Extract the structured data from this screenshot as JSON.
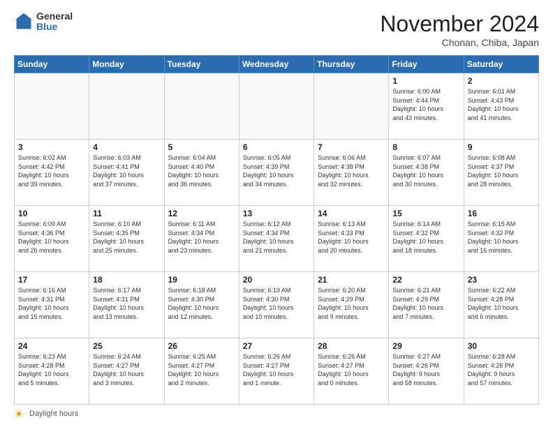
{
  "header": {
    "logo_general": "General",
    "logo_blue": "Blue",
    "month_title": "November 2024",
    "location": "Chonan, Chiba, Japan"
  },
  "calendar": {
    "days_of_week": [
      "Sunday",
      "Monday",
      "Tuesday",
      "Wednesday",
      "Thursday",
      "Friday",
      "Saturday"
    ],
    "weeks": [
      [
        {
          "day": "",
          "info": ""
        },
        {
          "day": "",
          "info": ""
        },
        {
          "day": "",
          "info": ""
        },
        {
          "day": "",
          "info": ""
        },
        {
          "day": "",
          "info": ""
        },
        {
          "day": "1",
          "info": "Sunrise: 6:00 AM\nSunset: 4:44 PM\nDaylight: 10 hours\nand 43 minutes."
        },
        {
          "day": "2",
          "info": "Sunrise: 6:01 AM\nSunset: 4:43 PM\nDaylight: 10 hours\nand 41 minutes."
        }
      ],
      [
        {
          "day": "3",
          "info": "Sunrise: 6:02 AM\nSunset: 4:42 PM\nDaylight: 10 hours\nand 39 minutes."
        },
        {
          "day": "4",
          "info": "Sunrise: 6:03 AM\nSunset: 4:41 PM\nDaylight: 10 hours\nand 37 minutes."
        },
        {
          "day": "5",
          "info": "Sunrise: 6:04 AM\nSunset: 4:40 PM\nDaylight: 10 hours\nand 36 minutes."
        },
        {
          "day": "6",
          "info": "Sunrise: 6:05 AM\nSunset: 4:39 PM\nDaylight: 10 hours\nand 34 minutes."
        },
        {
          "day": "7",
          "info": "Sunrise: 6:06 AM\nSunset: 4:38 PM\nDaylight: 10 hours\nand 32 minutes."
        },
        {
          "day": "8",
          "info": "Sunrise: 6:07 AM\nSunset: 4:38 PM\nDaylight: 10 hours\nand 30 minutes."
        },
        {
          "day": "9",
          "info": "Sunrise: 6:08 AM\nSunset: 4:37 PM\nDaylight: 10 hours\nand 28 minutes."
        }
      ],
      [
        {
          "day": "10",
          "info": "Sunrise: 6:09 AM\nSunset: 4:36 PM\nDaylight: 10 hours\nand 26 minutes."
        },
        {
          "day": "11",
          "info": "Sunrise: 6:10 AM\nSunset: 4:35 PM\nDaylight: 10 hours\nand 25 minutes."
        },
        {
          "day": "12",
          "info": "Sunrise: 6:11 AM\nSunset: 4:34 PM\nDaylight: 10 hours\nand 23 minutes."
        },
        {
          "day": "13",
          "info": "Sunrise: 6:12 AM\nSunset: 4:34 PM\nDaylight: 10 hours\nand 21 minutes."
        },
        {
          "day": "14",
          "info": "Sunrise: 6:13 AM\nSunset: 4:33 PM\nDaylight: 10 hours\nand 20 minutes."
        },
        {
          "day": "15",
          "info": "Sunrise: 6:14 AM\nSunset: 4:32 PM\nDaylight: 10 hours\nand 18 minutes."
        },
        {
          "day": "16",
          "info": "Sunrise: 6:15 AM\nSunset: 4:32 PM\nDaylight: 10 hours\nand 16 minutes."
        }
      ],
      [
        {
          "day": "17",
          "info": "Sunrise: 6:16 AM\nSunset: 4:31 PM\nDaylight: 10 hours\nand 15 minutes."
        },
        {
          "day": "18",
          "info": "Sunrise: 6:17 AM\nSunset: 4:31 PM\nDaylight: 10 hours\nand 13 minutes."
        },
        {
          "day": "19",
          "info": "Sunrise: 6:18 AM\nSunset: 4:30 PM\nDaylight: 10 hours\nand 12 minutes."
        },
        {
          "day": "20",
          "info": "Sunrise: 6:19 AM\nSunset: 4:30 PM\nDaylight: 10 hours\nand 10 minutes."
        },
        {
          "day": "21",
          "info": "Sunrise: 6:20 AM\nSunset: 4:29 PM\nDaylight: 10 hours\nand 9 minutes."
        },
        {
          "day": "22",
          "info": "Sunrise: 6:21 AM\nSunset: 4:29 PM\nDaylight: 10 hours\nand 7 minutes."
        },
        {
          "day": "23",
          "info": "Sunrise: 6:22 AM\nSunset: 4:28 PM\nDaylight: 10 hours\nand 6 minutes."
        }
      ],
      [
        {
          "day": "24",
          "info": "Sunrise: 6:23 AM\nSunset: 4:28 PM\nDaylight: 10 hours\nand 5 minutes."
        },
        {
          "day": "25",
          "info": "Sunrise: 6:24 AM\nSunset: 4:27 PM\nDaylight: 10 hours\nand 3 minutes."
        },
        {
          "day": "26",
          "info": "Sunrise: 6:25 AM\nSunset: 4:27 PM\nDaylight: 10 hours\nand 2 minutes."
        },
        {
          "day": "27",
          "info": "Sunrise: 6:26 AM\nSunset: 4:27 PM\nDaylight: 10 hours\nand 1 minute."
        },
        {
          "day": "28",
          "info": "Sunrise: 6:26 AM\nSunset: 4:27 PM\nDaylight: 10 hours\nand 0 minutes."
        },
        {
          "day": "29",
          "info": "Sunrise: 6:27 AM\nSunset: 4:26 PM\nDaylight: 9 hours\nand 58 minutes."
        },
        {
          "day": "30",
          "info": "Sunrise: 6:28 AM\nSunset: 4:26 PM\nDaylight: 9 hours\nand 57 minutes."
        }
      ]
    ]
  },
  "footer": {
    "daylight_label": "Daylight hours"
  }
}
